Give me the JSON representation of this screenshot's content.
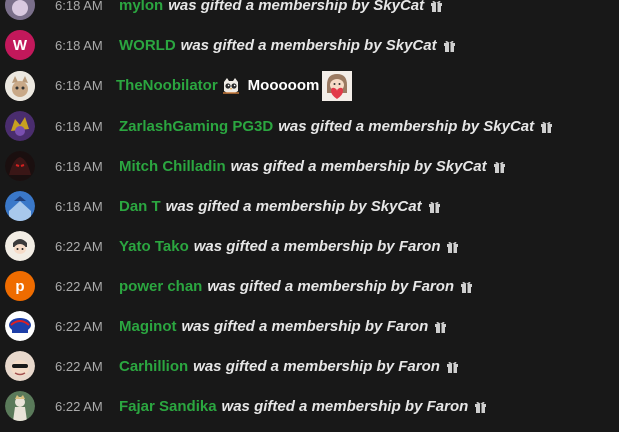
{
  "chat": {
    "gift_phrase": "was gifted a membership by",
    "messages": [
      {
        "time": "6:18 AM",
        "author": "mylon",
        "gifter": "SkyCat",
        "avatar": "mylon-avatar"
      },
      {
        "time": "6:18 AM",
        "author": "WORLD",
        "gifter": "SkyCat",
        "avatar_letter": "W",
        "avatar_color": "#c2185b"
      },
      {
        "time": "6:18 AM",
        "author": "TheNoobilator",
        "text": "Mooooom"
      },
      {
        "time": "6:18 AM",
        "author": "ZarlashGaming PG3D",
        "gifter": "SkyCat"
      },
      {
        "time": "6:18 AM",
        "author": "Mitch Chilladin",
        "gifter": "SkyCat"
      },
      {
        "time": "6:18 AM",
        "author": "Dan T",
        "gifter": "SkyCat"
      },
      {
        "time": "6:22 AM",
        "author": "Yato Tako",
        "gifter": "Faron"
      },
      {
        "time": "6:22 AM",
        "author": "power chan",
        "gifter": "Faron",
        "avatar_letter": "p",
        "avatar_color": "#ef6c00"
      },
      {
        "time": "6:22 AM",
        "author": "Maginot",
        "gifter": "Faron"
      },
      {
        "time": "6:22 AM",
        "author": "Carhillion",
        "gifter": "Faron"
      },
      {
        "time": "6:22 AM",
        "author": "Fajar Sandika",
        "gifter": "Faron"
      }
    ]
  },
  "colors": {
    "background": "#181818",
    "author": "#2ba640",
    "timestamp": "#aaaaaa",
    "gift_text": "#e6e6e6"
  },
  "icons": {
    "gift": "gift-icon",
    "emote_owl": "owl-emote-icon",
    "emote_heart": "heart-girl-emote-icon"
  }
}
